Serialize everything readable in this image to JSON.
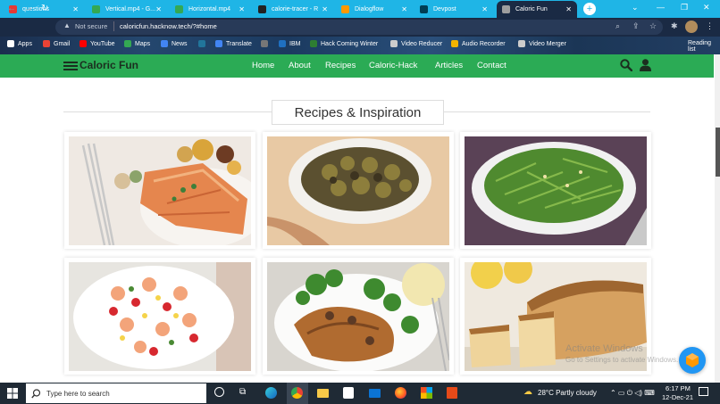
{
  "browser": {
    "tabs": [
      {
        "title": "questions",
        "fav_color": "#e53935"
      },
      {
        "title": "Vertical.mp4 - G...",
        "fav_color": "#34a853"
      },
      {
        "title": "Horizontal.mp4",
        "fav_color": "#34a853"
      },
      {
        "title": "calorie-tracer - R",
        "fav_color": "#222222"
      },
      {
        "title": "Dialogflow",
        "fav_color": "#ff9800"
      },
      {
        "title": "Devpost",
        "fav_color": "#003e54"
      },
      {
        "title": "Caloric Fun",
        "fav_color": "#9e9e9e"
      }
    ],
    "new_tab_icon": "plus-icon",
    "security_label": "Not secure",
    "url": "caloricfun.hacknow.tech/?#home",
    "bookmarks": [
      {
        "label": "Apps",
        "color": "#ffffff"
      },
      {
        "label": "Gmail",
        "color": "#ea4335"
      },
      {
        "label": "YouTube",
        "color": "#ff0000"
      },
      {
        "label": "Maps",
        "color": "#34a853"
      },
      {
        "label": "News",
        "color": "#4285f4"
      },
      {
        "label": "",
        "color": "#21759b"
      },
      {
        "label": "Translate",
        "color": "#4285f4"
      },
      {
        "label": "",
        "color": "#777777"
      },
      {
        "label": "IBM",
        "color": "#1f70c1"
      },
      {
        "label": "Hack Coming Winter",
        "color": "#2e7d32"
      },
      {
        "label": "Video Reducer",
        "color": "#cccccc"
      },
      {
        "label": "Audio Recorder",
        "color": "#f4b400"
      },
      {
        "label": "Video Merger",
        "color": "#cccccc"
      }
    ],
    "reading_list": "Reading list"
  },
  "site": {
    "logo": "Caloric Fun",
    "nav": [
      "Home",
      "About",
      "Recipes",
      "Caloric-Hack",
      "Articles",
      "Contact"
    ],
    "section_title": "Recipes & Inspiration",
    "recipes": [
      {
        "image": "grilled salmon with vegetables"
      },
      {
        "image": "roasted brussels sprouts"
      },
      {
        "image": "green beans with parmesan"
      },
      {
        "image": "shrimp salad with tomatoes and corn"
      },
      {
        "image": "chicken with mushrooms and broccoli"
      },
      {
        "image": "loaf of bread with lemons"
      }
    ],
    "watermark_title": "Activate Windows",
    "watermark_sub": "Go to Settings to activate Windows.",
    "brand_green": "#2bab55"
  },
  "taskbar": {
    "search_placeholder": "Type here to search",
    "weather": "28°C  Partly cloudy",
    "time": "6:17 PM",
    "date": "12-Dec-21"
  }
}
